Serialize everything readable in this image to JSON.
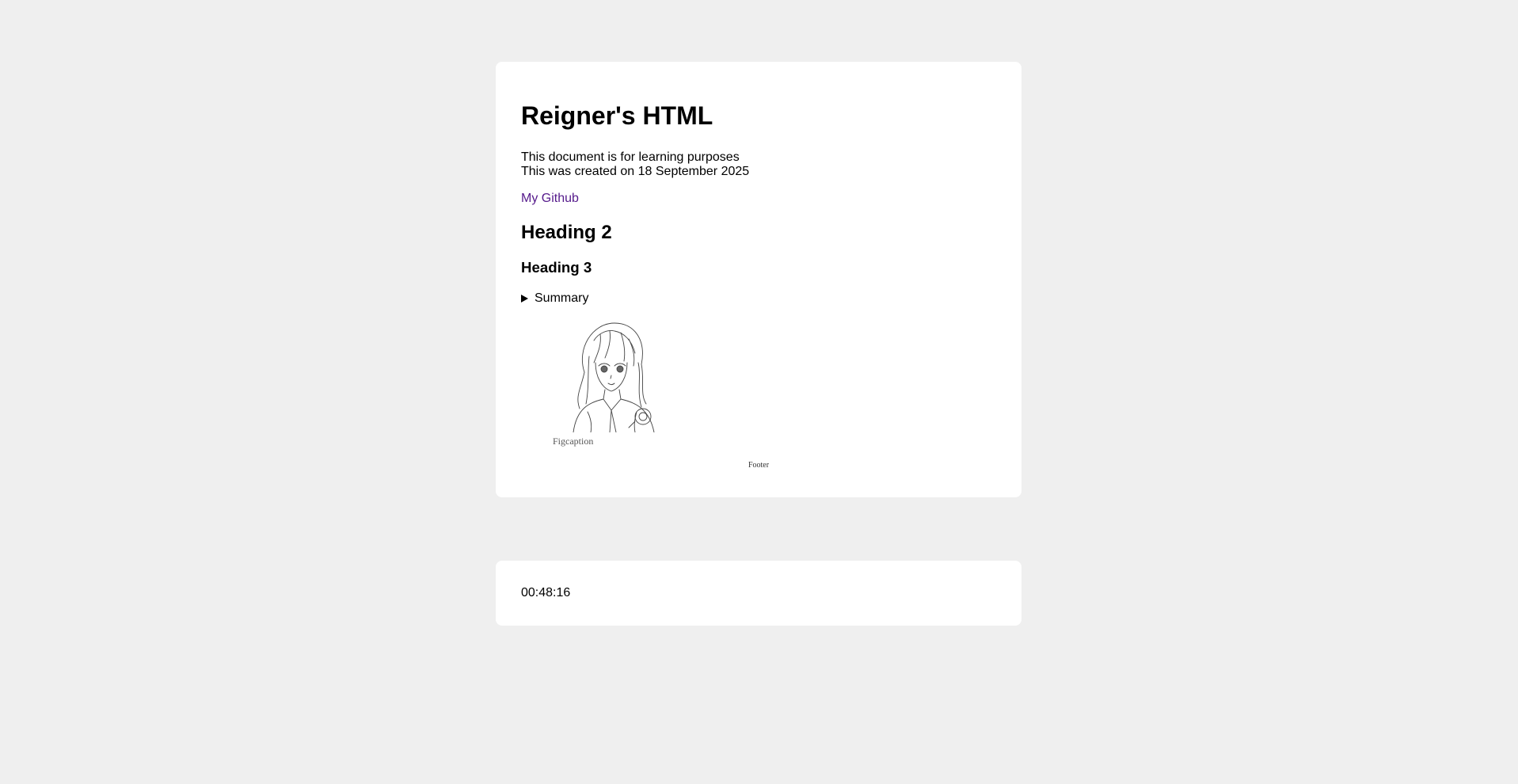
{
  "main": {
    "title": "Reigner's HTML",
    "intro_line1": "This document is for learning purposes",
    "intro_line2": "This was created on 18 September 2025",
    "link_label": "My Github",
    "heading2": "Heading 2",
    "heading3": "Heading 3",
    "summary_label": "Summary",
    "figure": {
      "icon": "anime-character-sketch",
      "caption": "Figcaption"
    },
    "footer": "Footer"
  },
  "clock": {
    "time": "00:48:16"
  },
  "colors": {
    "background": "#efefef",
    "card": "#ffffff",
    "link_visited": "#551a8b"
  }
}
